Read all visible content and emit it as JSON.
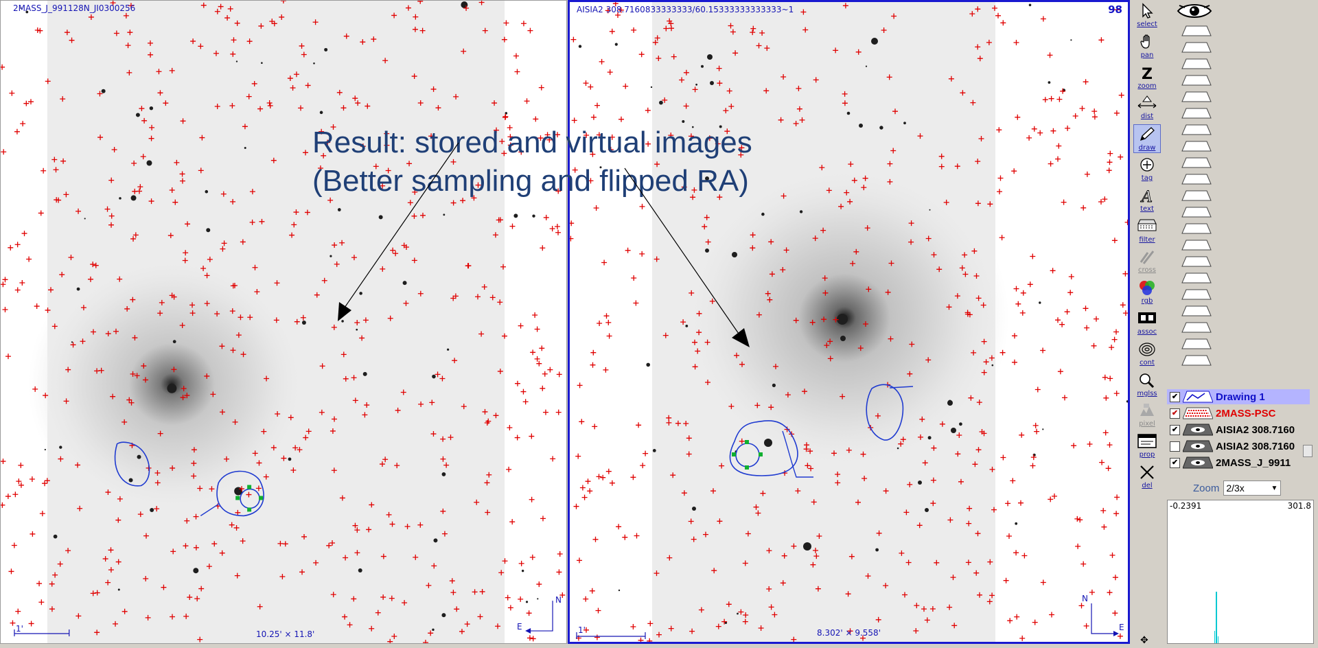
{
  "left_panel": {
    "title": "2MASS_J_991128N_JI0300256",
    "scale_label": "1'",
    "size_label": "10.25' × 11.8'",
    "compass_n": "N",
    "compass_e": "E"
  },
  "right_panel": {
    "title": "AISIA2 308.7160833333333/60.15333333333333~1",
    "frame_number": "98",
    "scale_label": "1'",
    "size_label": "8.302' × 9.558'",
    "compass_n": "N",
    "compass_e": "E"
  },
  "annotation": {
    "line1": "Result: stored and virtual images",
    "line2": "(Better sampling and flipped RA)"
  },
  "toolbar": [
    {
      "label": "select",
      "icon": "cursor-arrow-icon",
      "state": "normal"
    },
    {
      "label": "pan",
      "icon": "hand-icon",
      "state": "normal"
    },
    {
      "label": "zoom",
      "icon": "zoom-z-icon",
      "state": "normal"
    },
    {
      "label": "dist",
      "icon": "distance-icon",
      "state": "normal"
    },
    {
      "label": "draw",
      "icon": "pencil-icon",
      "state": "active"
    },
    {
      "label": "tag",
      "icon": "tag-icon",
      "state": "normal"
    },
    {
      "label": "text",
      "icon": "text-a-icon",
      "state": "normal"
    },
    {
      "label": "filter",
      "icon": "filter-icon",
      "state": "normal"
    },
    {
      "label": "cross",
      "icon": "crossmatch-icon",
      "state": "disabled"
    },
    {
      "label": "rgb",
      "icon": "rgb-icon",
      "state": "normal"
    },
    {
      "label": "assoc",
      "icon": "film-icon",
      "state": "normal"
    },
    {
      "label": "cont",
      "icon": "contour-icon",
      "state": "normal"
    },
    {
      "label": "mglss",
      "icon": "magnifier-icon",
      "state": "normal"
    },
    {
      "label": "pixel",
      "icon": "pixel-icon",
      "state": "disabled"
    },
    {
      "label": "prop",
      "icon": "properties-icon",
      "state": "normal"
    },
    {
      "label": "del",
      "icon": "delete-x-icon",
      "state": "normal"
    }
  ],
  "stack": {
    "planes": [
      {
        "name": "Drawing 1",
        "checked": true,
        "color": "#1010c8",
        "selected": true,
        "icon": "drawing-plane-icon"
      },
      {
        "name": "2MASS-PSC",
        "checked": true,
        "color": "#e00000",
        "selected": false,
        "icon": "catalog-plane-icon"
      },
      {
        "name": "AISIA2 308.7160",
        "checked": true,
        "color": "#000000",
        "selected": false,
        "icon": "image-plane-icon"
      },
      {
        "name": "AISIA2 308.7160",
        "checked": false,
        "color": "#000000",
        "selected": false,
        "icon": "image-plane-icon"
      },
      {
        "name": "2MASS_J_9911",
        "checked": true,
        "color": "#000000",
        "selected": false,
        "icon": "image-plane-icon"
      }
    ]
  },
  "zoom": {
    "label": "Zoom",
    "value": "2/3x"
  },
  "histogram": {
    "min": "-0.2391",
    "max": "301.8"
  },
  "colors": {
    "accent": "#1919d0",
    "catalog": "#e00000",
    "annotation": "#1f3f76"
  }
}
